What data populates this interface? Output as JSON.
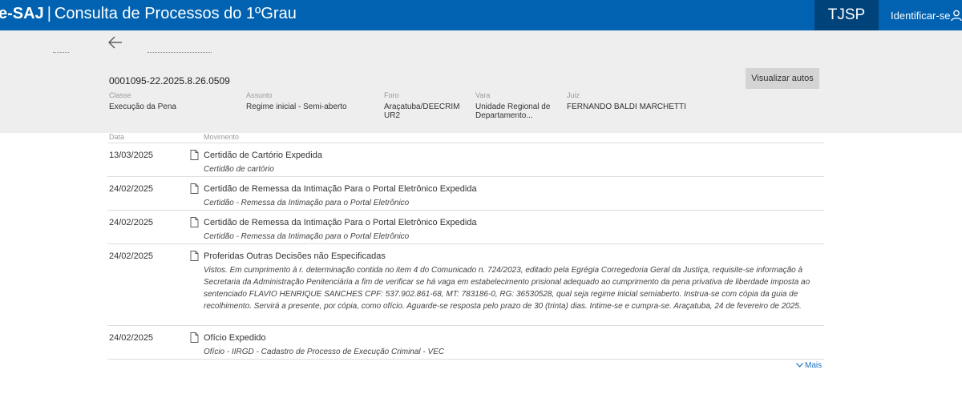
{
  "header": {
    "logo": "e-SAJ",
    "separator": "|",
    "app_title": "Consulta de Processos do 1ºGrau",
    "court": "TJSP",
    "login_label": "Identificar-se"
  },
  "process": {
    "number": "0001095-22.2025.8.26.0509",
    "view_button": "Visualizar autos",
    "fields": [
      {
        "label": "Classe",
        "value": "Execução da Pena"
      },
      {
        "label": "Assunto",
        "value": "Regime inicial - Semi-aberto"
      },
      {
        "label": "Foro",
        "value": "Araçatuba/DEECRIM UR2"
      },
      {
        "label": "Vara",
        "value": "Unidade Regional de Departamento..."
      },
      {
        "label": "Juiz",
        "value": "FERNANDO BALDI MARCHETTI"
      }
    ]
  },
  "movements": {
    "headers": {
      "date": "Data",
      "movement": "Movimento"
    },
    "rows": [
      {
        "date": "13/03/2025",
        "title": "Certidão de Cartório Expedida",
        "description": "Certidão de cartório"
      },
      {
        "date": "24/02/2025",
        "title": "Certidão de Remessa da Intimação Para o Portal Eletrônico Expedida",
        "description": "Certidão - Remessa da Intimação para o Portal Eletrônico"
      },
      {
        "date": "24/02/2025",
        "title": "Certidão de Remessa da Intimação Para o Portal Eletrônico Expedida",
        "description": "Certidão - Remessa da Intimação para o Portal Eletrônico"
      },
      {
        "date": "24/02/2025",
        "title": "Proferidas Outras Decisões não Especificadas",
        "description": "Vistos. Em cumprimento à r. determinação contida no item 4 do Comunicado n. 724/2023, editado pela Egrégia Corregedoria Geral da Justiça, requisite-se informação à Secretaria da Administração Penitenciária a fim de verificar se há vaga em estabelecimento prisional adequado ao cumprimento da pena privativa de liberdade imposta ao sentenciado FLAVIO HENRIQUE SANCHES CPF: 537.902.861-68, MT: 783186-0, RG: 36530528, qual seja regime inicial semiaberto. Instrua-se com cópia da guia de recolhimento. Servirá a presente, por cópia, como ofício. Aguarde-se resposta pelo prazo de 30 (trinta) dias. Intime-se e cumpra-se. Araçatuba, 24 de fevereiro de 2025."
      },
      {
        "date": "24/02/2025",
        "title": "Ofício Expedido",
        "description": "Ofício - IIRGD - Cadastro de Processo de Execução Criminal - VEC"
      }
    ],
    "more_label": "Mais"
  }
}
